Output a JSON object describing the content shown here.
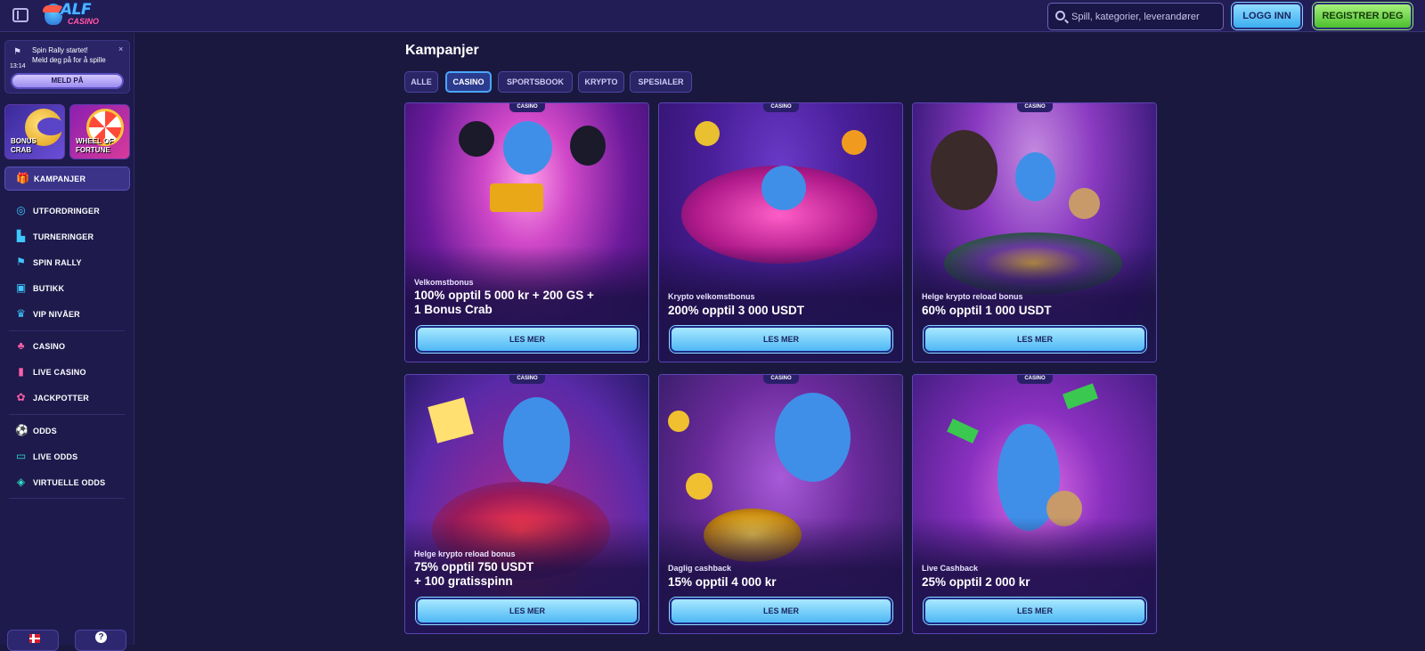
{
  "header": {
    "logo_text": "ALF",
    "logo_sub": "CASINO",
    "search_placeholder": "Spill, kategorier, leverandører",
    "login_label": "LOGG INN",
    "register_label": "REGISTRER DEG"
  },
  "notification": {
    "title": "Spin Rally startet!",
    "body": "Meld deg på for å spille",
    "time": "13:14",
    "close": "×",
    "button": "MELD PÅ"
  },
  "tiles": [
    {
      "label_line1": "BONUS",
      "label_line2": "CRAB"
    },
    {
      "label_line1": "WHEEL OF",
      "label_line2": "FORTUNE"
    }
  ],
  "nav": {
    "active": {
      "label": "KAMPANJER",
      "icon": "gift-icon"
    },
    "items": [
      {
        "label": "UTFORDRINGER",
        "icon": "medal-icon"
      },
      {
        "label": "TURNERINGER",
        "icon": "tournament-icon"
      },
      {
        "label": "SPIN RALLY",
        "icon": "flag-icon"
      },
      {
        "label": "BUTIKK",
        "icon": "shop-bag-icon"
      },
      {
        "label": "VIP NIVÅER",
        "icon": "crown-icon"
      },
      {
        "label": "CASINO",
        "icon": "cherry-icon"
      },
      {
        "label": "LIVE CASINO",
        "icon": "live-cards-icon"
      },
      {
        "label": "JACKPOTTER",
        "icon": "clover-icon"
      },
      {
        "label": "ODDS",
        "icon": "football-icon"
      },
      {
        "label": "LIVE ODDS",
        "icon": "live-ticket-icon"
      },
      {
        "label": "VIRTUELLE ODDS",
        "icon": "gamepad-icon"
      }
    ],
    "help": "?"
  },
  "main": {
    "title": "Kampanjer",
    "filters": [
      "ALLE",
      "CASINO",
      "SPORTSBOOK",
      "KRYPTO",
      "SPESIALER"
    ],
    "active_filter": "CASINO",
    "cards": [
      {
        "badge": "CASINO",
        "subtitle": "Velkomstbonus",
        "title_line1": "100% opptil 5 000 kr + 200 GS +",
        "title_line2": "1 Bonus Crab",
        "button": "LES MER"
      },
      {
        "badge": "CASINO",
        "subtitle": "Krypto velkomstbonus",
        "title_line1": "200% opptil 3 000 USDT",
        "title_line2": "",
        "button": "LES MER"
      },
      {
        "badge": "CASINO",
        "subtitle": "Helge krypto reload bonus",
        "title_line1": "60% opptil 1 000 USDT",
        "title_line2": "",
        "button": "LES MER"
      },
      {
        "badge": "CASINO",
        "subtitle": "Helge krypto reload bonus",
        "title_line1": "75% opptil 750 USDT",
        "title_line2": "+ 100 gratisspinn",
        "button": "LES MER"
      },
      {
        "badge": "CASINO",
        "subtitle": "Daglig cashback",
        "title_line1": "15% opptil 4 000 kr",
        "title_line2": "",
        "button": "LES MER"
      },
      {
        "badge": "CASINO",
        "subtitle": "Live Cashback",
        "title_line1": "25% opptil 2 000 kr",
        "title_line2": "",
        "button": "LES MER"
      }
    ]
  },
  "colors": {
    "background": "#1b1840",
    "header": "#221d55",
    "accent_blue": "#4eb8f5",
    "accent_green": "#4cbf2e"
  }
}
